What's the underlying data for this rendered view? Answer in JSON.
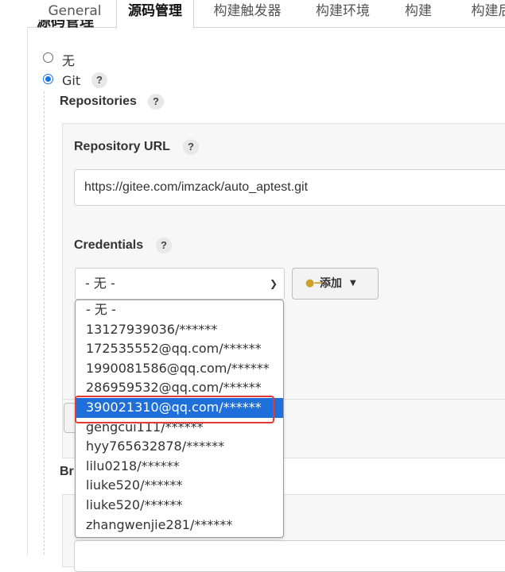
{
  "tabs": [
    {
      "label": "General"
    },
    {
      "label": "源码管理"
    },
    {
      "label": "构建触发器"
    },
    {
      "label": "构建环境"
    },
    {
      "label": "构建"
    },
    {
      "label": "构建后"
    }
  ],
  "section_title": "源码管理",
  "scm": {
    "none_label": "无",
    "git_label": "Git",
    "selected": "Git"
  },
  "help_glyph": "?",
  "repositories_label": "Repositories",
  "repo_url_label": "Repository URL",
  "repo_url_value": "https://gitee.com/imzack/auto_aptest.git",
  "credentials_label": "Credentials",
  "credentials_selected": "- 无 -",
  "add_button_label": "添加",
  "branches_label_partial": "Br",
  "credentials_options": [
    "- 无 -",
    "13127939036/******",
    "172535552@qq.com/******",
    "1990081586@qq.com/******",
    "286959532@qq.com/******",
    "390021310@qq.com/******",
    "gengcui111/******",
    "hyy765632878/******",
    "lilu0218/******",
    "liuke520/******",
    "liuke520/******",
    "zhangwenjie281/******"
  ],
  "highlighted_option_index": 5,
  "colors": {
    "accent": "#1e6fd9",
    "highlight_box": "#e53935"
  }
}
